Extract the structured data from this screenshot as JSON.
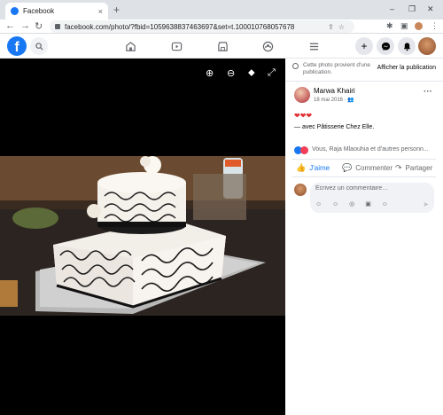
{
  "browser": {
    "tab_title": "Facebook",
    "url": "facebook.com/photo/?fbid=1059638837463697&set=t.100010768057678",
    "new_tab": "+",
    "tab_close": "×",
    "win_minimize": "–",
    "win_maximize": "❐",
    "win_close": "✕",
    "back": "←",
    "forward": "→",
    "reload": "↻"
  },
  "header": {
    "logo": "f",
    "create": "+"
  },
  "photo_toolbar": {
    "zoom_in": "⊕",
    "zoom_out": "⊖",
    "tag": "⬥",
    "fullscreen": "⤢"
  },
  "side": {
    "notice": "Cette photo provient d'une publication.",
    "show_post": "Afficher la publication"
  },
  "post": {
    "author": "Marwa Khairi",
    "date": "18 mai 2016 · 👥",
    "more": "···",
    "hearts": "❤❤❤",
    "with_text": "— avec Pâtisserie Chez Elle.",
    "reactions_text": "Vous, Raja Mlaouhia et d'autres personn...",
    "like_label": "J'aime",
    "comment_label": "Commenter",
    "share_label": "Partager",
    "like_icon": "👍",
    "comment_icon": "💬",
    "share_icon": "↷"
  },
  "comment_box": {
    "placeholder": "Écrivez un commentaire…",
    "icons": "☺ ☺ ◎ ▣ ☺",
    "send": "➤"
  }
}
